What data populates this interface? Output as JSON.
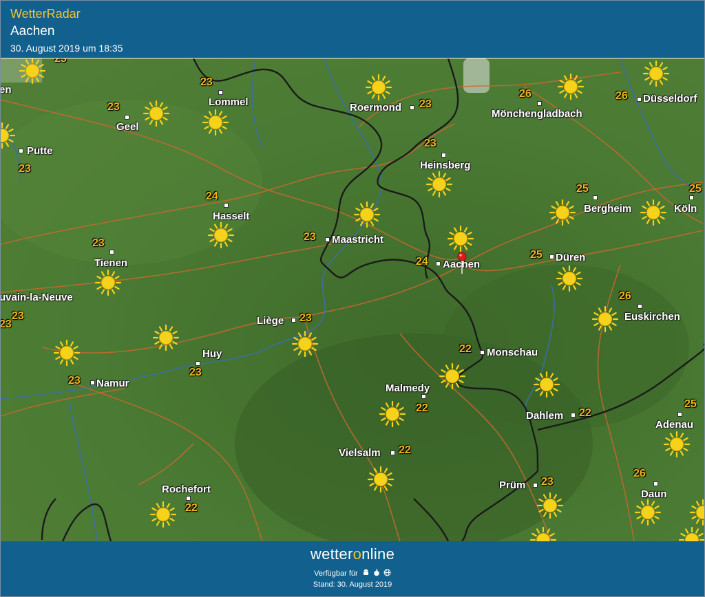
{
  "header": {
    "brand": "WetterRadar",
    "location": "Aachen",
    "timestamp": "30. August 2019 um 18:35"
  },
  "map": {
    "cities": [
      {
        "name": "Lommel"
      },
      {
        "name": "Geel"
      },
      {
        "name": "Putte"
      },
      {
        "name": "Hasselt"
      },
      {
        "name": "Tienen"
      },
      {
        "name": "uvain-la-Neuve"
      },
      {
        "name": "Roermond"
      },
      {
        "name": "Mönchengladbach"
      },
      {
        "name": "Düsseldorf"
      },
      {
        "name": "Heinsberg"
      },
      {
        "name": "Bergheim"
      },
      {
        "name": "Köln"
      },
      {
        "name": "Maastricht"
      },
      {
        "name": "Aachen"
      },
      {
        "name": "Düren"
      },
      {
        "name": "Liège"
      },
      {
        "name": "Euskirchen"
      },
      {
        "name": "Monschau"
      },
      {
        "name": "Huy"
      },
      {
        "name": "Namur"
      },
      {
        "name": "Malmedy"
      },
      {
        "name": "Dahlem"
      },
      {
        "name": "Adenau"
      },
      {
        "name": "Vielsalm"
      },
      {
        "name": "Prüm"
      },
      {
        "name": "Rochefort"
      },
      {
        "name": "Daun"
      },
      {
        "name": "en"
      }
    ],
    "temperatures": [
      "23",
      "23",
      "23",
      "23",
      "24",
      "23",
      "23",
      "23",
      "26",
      "26",
      "23",
      "25",
      "25",
      "23",
      "24",
      "25",
      "23",
      "26",
      "22",
      "23",
      "23",
      "22",
      "22",
      "25",
      "22",
      "23",
      "26",
      "22",
      "23"
    ],
    "icons": [
      "sun-icon",
      "location-pin-icon"
    ],
    "colors": {
      "map_green": "#4a7a33",
      "border": "#1b1b1b",
      "roads": "#c8692e",
      "rivers": "#3b6fa8",
      "temp_text": "#f2b51d",
      "sun": "#f7d21a"
    }
  },
  "footer": {
    "logo_before": "wetter",
    "logo_o": "o",
    "logo_after": "nline",
    "available": "Verfügbar für",
    "platform_icons": [
      "android-icon",
      "apple-icon",
      "web-icon"
    ],
    "stand": "Stand: 30. August 2019"
  }
}
